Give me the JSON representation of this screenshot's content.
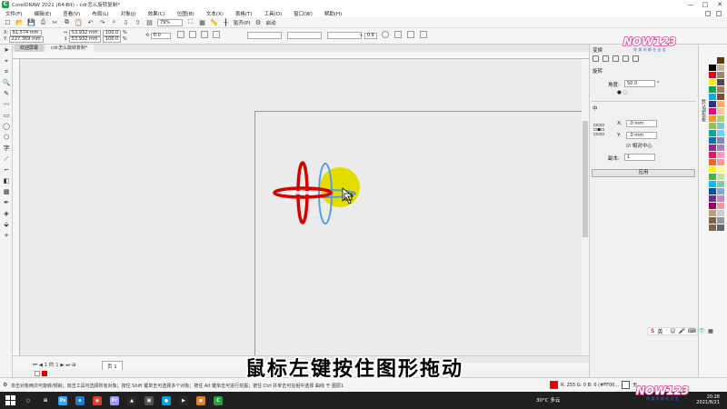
{
  "window": {
    "title": "CorelDRAW 2021 (64-Bit) - cdr怎么旋转复制*",
    "controls": [
      "—",
      "□",
      "✕"
    ]
  },
  "menu": [
    "文件(F)",
    "编辑(E)",
    "查看(V)",
    "布局(L)",
    "对象(J)",
    "效果(C)",
    "位图(B)",
    "文本(X)",
    "表格(T)",
    "工具(O)",
    "窗口(W)",
    "帮助(H)"
  ],
  "toolbar": {
    "zoom": "79%",
    "snap_label": "贴齐(P)",
    "launch_label": "启动"
  },
  "property_bar": {
    "x": "61.574 mm",
    "y": "227.369 mm",
    "w": "53.932 mm",
    "h": "53.932 mm",
    "w_pct": "100.0",
    "h_pct": "100.0",
    "pct_unit": "%",
    "angle": "0.0",
    "outline": "0.9"
  },
  "doc_tabs": [
    "欢迎屏幕",
    "cdr怎么旋转复制*"
  ],
  "page_nav": {
    "counter": "1 的 1",
    "page_tab": "页 1"
  },
  "docker": {
    "title": "变换",
    "section_rotate": "旋转",
    "angle_label": "角度:",
    "angle_value": "50.0",
    "angle_unit": "°",
    "section_center": "中",
    "x_label": "X:",
    "x_value": ".0 mm",
    "y_label": "Y:",
    "y_value": ".0 mm",
    "relative_label": "相对中心",
    "copies_label": "副本:",
    "copies_value": "1",
    "apply_label": "应用"
  },
  "palette": {
    "label": "默认调色板",
    "colors": [
      "#ffffff",
      "#000000",
      "#e30613",
      "#ffed00",
      "#00a650",
      "#00aeef",
      "#2e3192",
      "#ec008c",
      "#f7941d",
      "#8dc63f",
      "#00a99d",
      "#0072bc",
      "#92278f",
      "#ed145b",
      "#f26522",
      "#fff200",
      "#39b54a",
      "#00bff3",
      "#0054a6",
      "#662d91",
      "#9e005d",
      "#c69c6d",
      "#736357",
      "#8c6239",
      "#603913",
      "#c7b299",
      "#998675",
      "#534741",
      "#a67c52",
      "#754c24",
      "#fbaf5d",
      "#fdc689",
      "#acd373",
      "#7accc8",
      "#6dcff6",
      "#8781bd",
      "#a186be",
      "#f49ac1",
      "#f6989d",
      "#fff799",
      "#c4df9b",
      "#82ca9c",
      "#7ea7d8",
      "#bd8cbf",
      "#f5989d",
      "#cccccc",
      "#999999",
      "#666666"
    ]
  },
  "ime_bar": [
    "S",
    "英",
    "·",
    "☺",
    "🎤",
    "⌨",
    "👕",
    "▦"
  ],
  "status": {
    "text": "单击对象两次可旋转/倾斜；双击工具可选择所有对象；按住 Shift 键单击可选择多个对象；按住 Alt 键单击可进行挖掘；按住 Ctrl 并单击可在组中选择    曲线 于 图层1",
    "fill_info": "R: 255 G: 0 B: 0 (#FF00...",
    "outline_info": "无"
  },
  "taskbar": {
    "weather": "30°C 多云",
    "time": "20:28",
    "date": "2021/8/21",
    "apps": [
      {
        "label": "○",
        "color": "#202020"
      },
      {
        "label": "⊞",
        "color": "#202020"
      },
      {
        "label": "Ps",
        "color": "#31a8ff"
      },
      {
        "label": "e",
        "color": "#1e7bd4"
      },
      {
        "label": "◉",
        "color": "#e33b2e"
      },
      {
        "label": "Pr",
        "color": "#9999ff"
      },
      {
        "label": "▲",
        "color": "#2a2a2a"
      },
      {
        "label": "▣",
        "color": "#555555"
      },
      {
        "label": "●",
        "color": "#00a0e9"
      },
      {
        "label": "▶",
        "color": "#2a2a2a"
      },
      {
        "label": "◼",
        "color": "#e67e22"
      },
      {
        "label": "C",
        "color": "#21a044"
      }
    ]
  },
  "watermark": "NOW123",
  "watermark_tagline": "你 要 的 都 在 这 里",
  "caption": "鼠标左键按住图形拖动",
  "accent": {
    "red": "#d40000",
    "yellow": "#e6dd00",
    "blue": "#5aa0d8"
  }
}
